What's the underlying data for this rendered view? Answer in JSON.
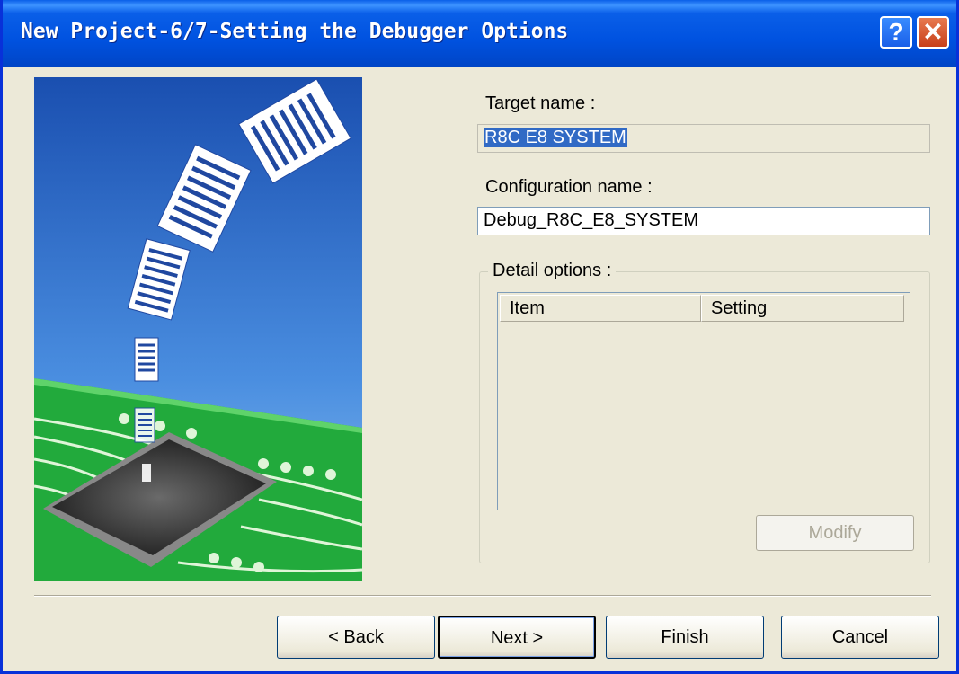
{
  "window": {
    "title": "New Project-6/7-Setting the Debugger Options",
    "help_glyph": "?",
    "close_glyph": "✕"
  },
  "form": {
    "target_label": "Target name :",
    "target_value": "R8C E8 SYSTEM",
    "config_label": "Configuration name :",
    "config_value": "Debug_R8C_E8_SYSTEM",
    "detail_label": "Detail options :",
    "columns": [
      "Item",
      "Setting"
    ],
    "modify_label": "Modify"
  },
  "buttons": {
    "back": "< Back",
    "next": "Next >",
    "finish": "Finish",
    "cancel": "Cancel"
  },
  "colors": {
    "titlebar": "#0054e3",
    "selection": "#316ac5",
    "board": "#22aa3c",
    "sky": "#3a7bd8"
  }
}
